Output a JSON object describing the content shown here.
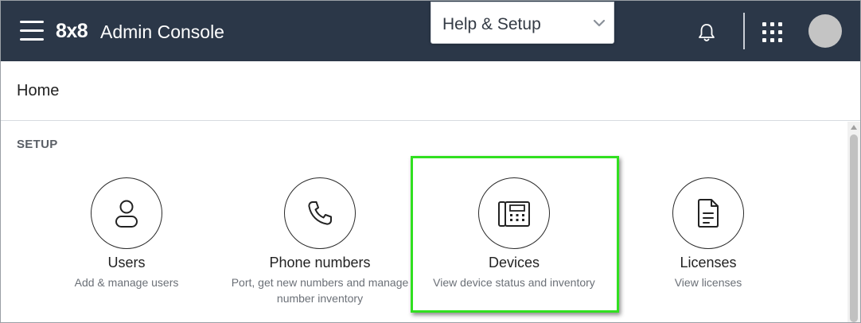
{
  "header": {
    "logo_text": "8x8",
    "title": "Admin Console",
    "help_dropdown": {
      "label": "Help & Setup"
    },
    "colors": {
      "bar": "#2b3748",
      "avatar": "#c4c4c4"
    }
  },
  "breadcrumb": {
    "current": "Home"
  },
  "setup": {
    "section_title": "SETUP",
    "tiles": [
      {
        "name": "Users",
        "description": "Add & manage users",
        "icon": "user-icon"
      },
      {
        "name": "Phone numbers",
        "description": "Port, get new numbers and manage number inventory",
        "icon": "phone-icon"
      },
      {
        "name": "Devices",
        "description": "View device status and inventory",
        "icon": "desk-phone-icon"
      },
      {
        "name": "Licenses",
        "description": "View licenses",
        "icon": "document-icon"
      }
    ]
  },
  "highlight": {
    "color": "#31e020",
    "target": "Devices"
  }
}
